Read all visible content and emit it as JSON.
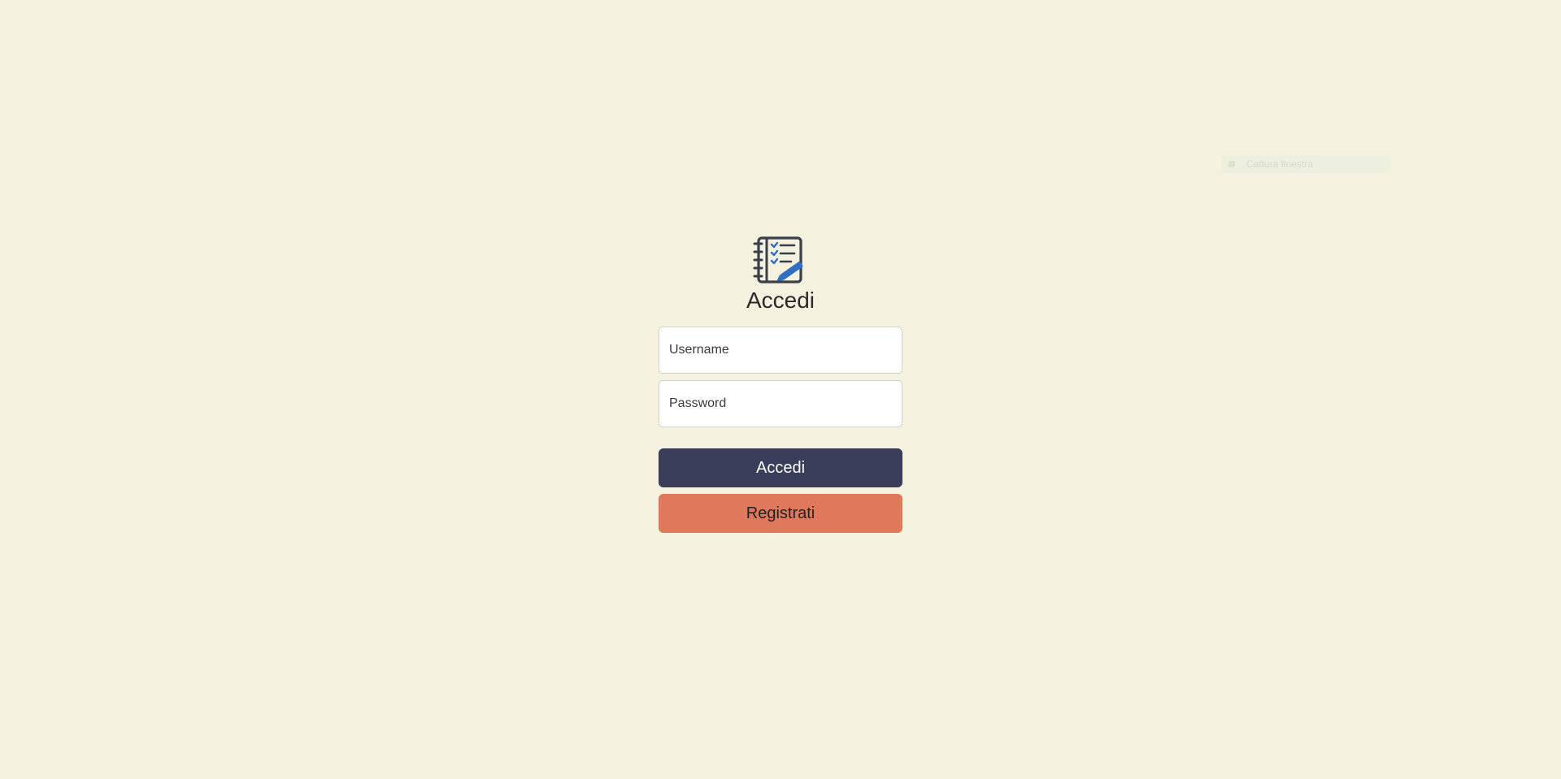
{
  "capture_overlay": {
    "label": "Cattura finestra",
    "icon": "capture-icon"
  },
  "login": {
    "logo_icon": "checklist-notebook-icon",
    "title": "Accedi",
    "username_placeholder": "Username",
    "password_placeholder": "Password",
    "login_button_label": "Accedi",
    "register_button_label": "Registrati"
  },
  "colors": {
    "background": "#f5f1df",
    "login_button": "#3b3e5b",
    "register_button": "#e0785b",
    "logo_accent": "#2e6fc4",
    "logo_dark": "#3a3f4a"
  }
}
